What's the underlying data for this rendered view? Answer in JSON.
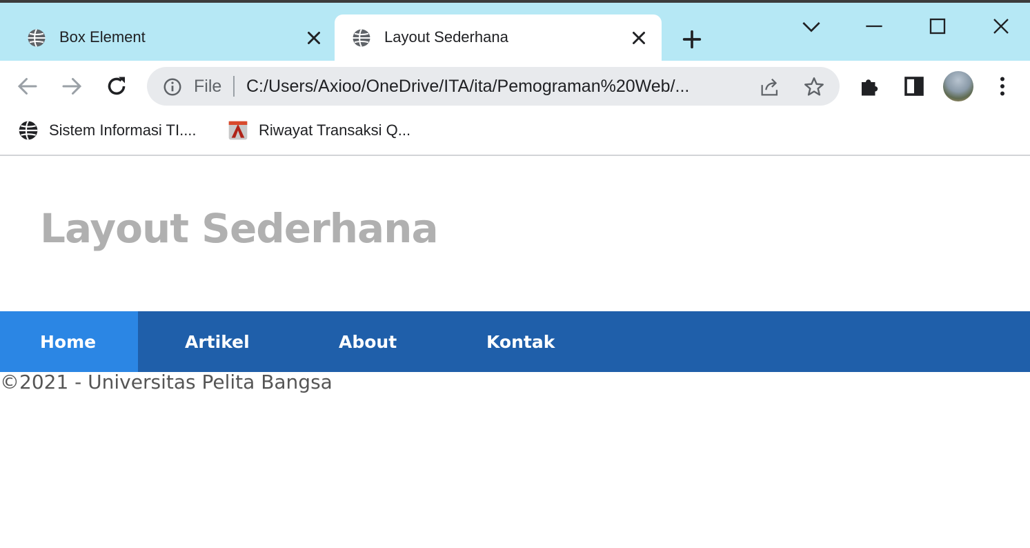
{
  "browser": {
    "tabs": [
      {
        "title": "Box Element",
        "active": false
      },
      {
        "title": "Layout Sederhana",
        "active": true
      }
    ],
    "address_bar": {
      "scheme_label": "File",
      "url": "C:/Users/Axioo/OneDrive/ITA/ita/Pemograman%20Web/..."
    },
    "bookmarks": [
      {
        "label": "Sistem Informasi TI...."
      },
      {
        "label": "Riwayat Transaksi Q..."
      }
    ]
  },
  "page": {
    "title": "Layout Sederhana",
    "nav": [
      {
        "label": "Home",
        "active": true
      },
      {
        "label": "Artikel",
        "active": false
      },
      {
        "label": "About",
        "active": false
      },
      {
        "label": "Kontak",
        "active": false
      }
    ],
    "footer": "©2021 - Universitas Pelita Bangsa"
  },
  "colors": {
    "tabstrip_bg": "#b6e8f5",
    "nav_bg": "#1f5faa",
    "nav_active_bg": "#2b86e4",
    "title_color": "#b0b0b0",
    "footer_color": "#555555"
  }
}
